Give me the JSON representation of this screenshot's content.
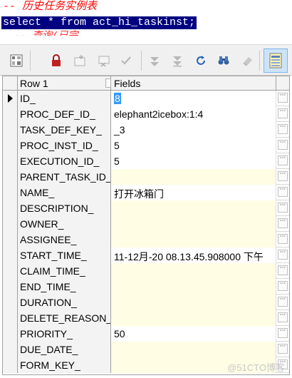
{
  "sql": {
    "comment": "-- 历史任务实例表",
    "query": "select * from act_hi_taskinst;",
    "partial_line": "-- 查询(已完..."
  },
  "toolbar": {
    "buttons": [
      {
        "icon": "grid-options-icon",
        "enabled": true
      },
      {
        "icon": "lock-icon",
        "enabled": true
      },
      {
        "icon": "add-record-icon",
        "enabled": false
      },
      {
        "icon": "delete-record-icon",
        "enabled": false
      },
      {
        "icon": "post-checkmark-icon",
        "enabled": false
      },
      {
        "icon": "first-record-icon",
        "enabled": false
      },
      {
        "icon": "last-record-icon",
        "enabled": false
      },
      {
        "icon": "refresh-icon",
        "enabled": true
      },
      {
        "icon": "find-binoculars-icon",
        "enabled": true
      },
      {
        "icon": "clear-eraser-icon",
        "enabled": false
      },
      {
        "icon": "single-record-view-icon",
        "enabled": true,
        "active": true
      }
    ]
  },
  "grid": {
    "header": {
      "row_label": "Row 1",
      "fields_label": "Fields"
    },
    "rows": [
      {
        "name": "ID_",
        "value": "8",
        "selected": true
      },
      {
        "name": "PROC_DEF_ID_",
        "value": "elephant2icebox:1:4"
      },
      {
        "name": "TASK_DEF_KEY_",
        "value": "_3"
      },
      {
        "name": "PROC_INST_ID_",
        "value": "5"
      },
      {
        "name": "EXECUTION_ID_",
        "value": "5"
      },
      {
        "name": "PARENT_TASK_ID_",
        "value": ""
      },
      {
        "name": "NAME_",
        "value": "打开冰箱门"
      },
      {
        "name": "DESCRIPTION_",
        "value": ""
      },
      {
        "name": "OWNER_",
        "value": ""
      },
      {
        "name": "ASSIGNEE_",
        "value": ""
      },
      {
        "name": "START_TIME_",
        "value": "11-12月-20 08.13.45.908000 下午"
      },
      {
        "name": "CLAIM_TIME_",
        "value": ""
      },
      {
        "name": "END_TIME_",
        "value": ""
      },
      {
        "name": "DURATION_",
        "value": ""
      },
      {
        "name": "DELETE_REASON_",
        "value": ""
      },
      {
        "name": "PRIORITY_",
        "value": "50"
      },
      {
        "name": "DUE_DATE_",
        "value": ""
      },
      {
        "name": "FORM_KEY_",
        "value": ""
      }
    ]
  },
  "watermark": "@51CTO博客",
  "colors": {
    "comment": "#ff0000",
    "selection_bg": "#000080",
    "null_cell_bg": "#fffde4",
    "active_tool_bg": "#cde4f7"
  }
}
